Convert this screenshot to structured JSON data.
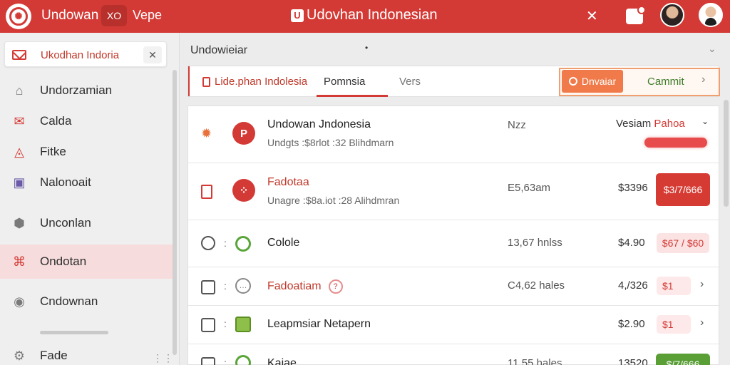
{
  "topbar": {
    "app_name": "Undowan",
    "chip_label": "XO",
    "tab2_label": "Vepe",
    "center_title": "Udovhan Indonesian",
    "center_badge": "U",
    "close_glyph": "✕",
    "brand_color": "#d43a35"
  },
  "sidebar": {
    "header_label": "Ukodhan Indoria",
    "header_close": "✕",
    "items": [
      {
        "label": "Undorzamian",
        "icon": "home-icon"
      },
      {
        "label": "Calda",
        "icon": "mail-icon"
      },
      {
        "label": "Fitke",
        "icon": "chart-icon"
      },
      {
        "label": "Nalonoait",
        "icon": "notebook-icon"
      },
      {
        "label": "Unconlan",
        "icon": "location-icon"
      },
      {
        "label": "Ondotan",
        "icon": "building-icon",
        "active": true
      },
      {
        "label": "Cndownan",
        "icon": "help-icon"
      },
      {
        "label": "Fade",
        "icon": "gear-icon"
      }
    ],
    "footer_dots": "⋮⋮"
  },
  "main": {
    "title": "Undowieiar",
    "tabs": [
      {
        "label": "Lide.phan Indolesia"
      },
      {
        "label": "Pomnsia",
        "active": true
      },
      {
        "label": "Vers"
      }
    ],
    "action_button": "Dnvaiar",
    "commit_label": "Cammit",
    "rows": [
      {
        "name": "Undowan Jndonesia",
        "sub": "Undgts :$8rlot :32 Blihdmarn",
        "mid": "Nzz",
        "price": "Vesiam",
        "price_accent": "Pahoa",
        "pill": ""
      },
      {
        "name": "Fadotaa",
        "sub": "Unagre :$8a.iot :28 Alihdmran",
        "mid": "E5,63am",
        "price": "$3396",
        "pill": "$3/7/666"
      },
      {
        "name": "Colole",
        "sub": "",
        "mid": "13,67 hnlss",
        "price": "$4.90",
        "pill": "$67 / $60"
      },
      {
        "name": "Fadoatiam",
        "sub": "",
        "mid": "C4,62 hales",
        "price": "4,/326",
        "pill": "$1"
      },
      {
        "name": "Leapmsiar Netapern",
        "sub": "",
        "mid": "",
        "price": "$2.90",
        "pill": "$1"
      },
      {
        "name": "Kaiae",
        "sub": "",
        "mid": "11,55 hales",
        "price": "13520",
        "pill": "$/7/666"
      }
    ]
  }
}
